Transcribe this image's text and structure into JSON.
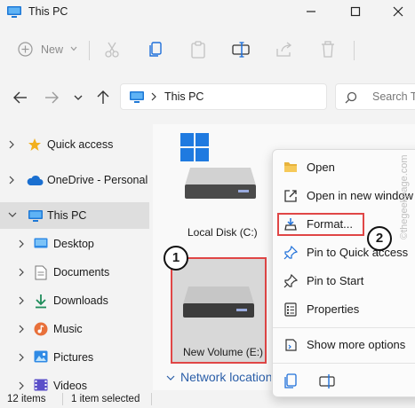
{
  "window": {
    "title": "This PC"
  },
  "toolbar": {
    "new_label": "New"
  },
  "address": {
    "location": "This PC"
  },
  "search": {
    "placeholder": "Search This PC"
  },
  "sidebar": {
    "items": [
      {
        "label": "Quick access"
      },
      {
        "label": "OneDrive - Personal"
      },
      {
        "label": "This PC"
      },
      {
        "label": "Desktop"
      },
      {
        "label": "Documents"
      },
      {
        "label": "Downloads"
      },
      {
        "label": "Music"
      },
      {
        "label": "Pictures"
      },
      {
        "label": "Videos"
      }
    ]
  },
  "content": {
    "drives": [
      {
        "label": "Local Disk (C:)"
      },
      {
        "label": "New Volume (E:)"
      }
    ],
    "network_section": "Network locations"
  },
  "status": {
    "items_count": "12 items",
    "selected": "1 item selected"
  },
  "context_menu": {
    "items": [
      {
        "label": "Open"
      },
      {
        "label": "Open in new window"
      },
      {
        "label": "Format..."
      },
      {
        "label": "Pin to Quick access"
      },
      {
        "label": "Pin to Start"
      },
      {
        "label": "Properties"
      },
      {
        "label": "Show more options"
      }
    ]
  },
  "annotations": {
    "step1": "1",
    "step2": "2"
  },
  "watermark": "©thegeekpage.com",
  "colors": {
    "highlight": "#e04646",
    "accent": "#1e6fd9",
    "selected_bg": "#dedede"
  }
}
